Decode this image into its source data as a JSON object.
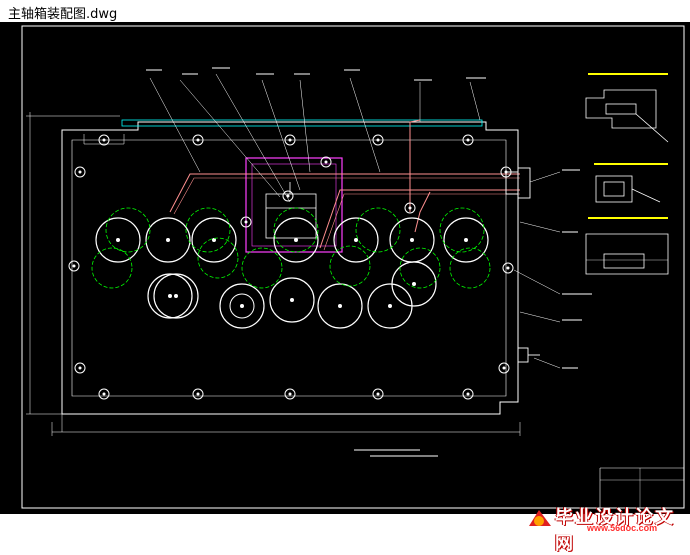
{
  "window": {
    "title": "主轴箱装配图.dwg"
  },
  "drawing": {
    "line_color": "#ffffff",
    "hole_color": "#ffffff",
    "pitch_circle_color": "#00ff00",
    "housing_color": "#ff40ff",
    "pipe_color": "#ff9090",
    "accent_color": "#ffff00",
    "dimension_color": "#00ffff"
  },
  "watermark": {
    "text": "毕业设计论文网",
    "url": "www.56doc.com"
  }
}
